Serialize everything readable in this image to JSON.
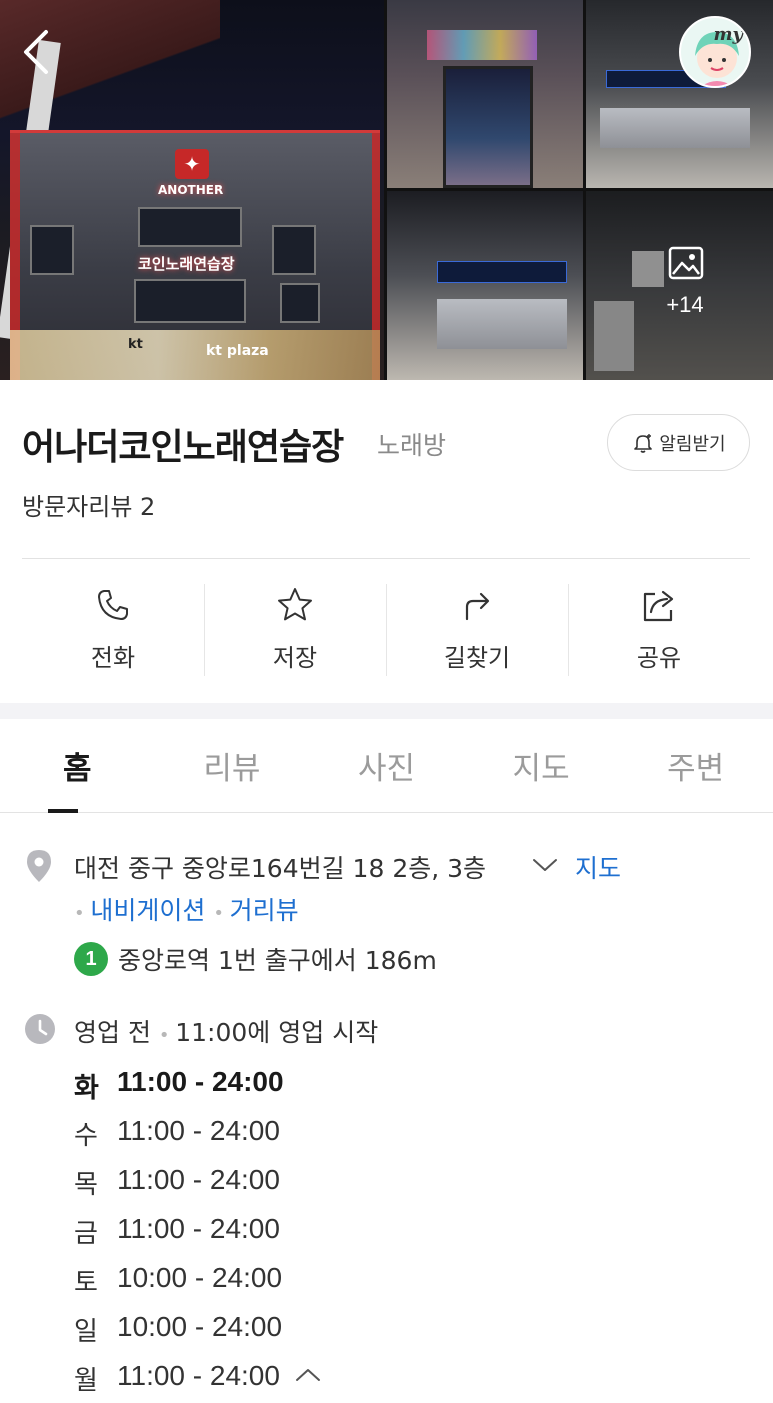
{
  "gallery": {
    "signs": {
      "brand": "ANOTHER",
      "korean": "코인노래연습장",
      "kt": "kt",
      "kt_plaza": "kt plaza"
    },
    "more_count": "+14",
    "my_badge": "my"
  },
  "place": {
    "title": "어나더코인노래연습장",
    "category": "노래방",
    "alert_label": "알림받기",
    "review_count": "방문자리뷰 2"
  },
  "actions": [
    {
      "label": "전화",
      "icon": "phone-icon"
    },
    {
      "label": "저장",
      "icon": "star-icon"
    },
    {
      "label": "길찾기",
      "icon": "directions-icon"
    },
    {
      "label": "공유",
      "icon": "share-icon"
    }
  ],
  "tabs": [
    {
      "label": "홈",
      "active": true
    },
    {
      "label": "리뷰",
      "active": false
    },
    {
      "label": "사진",
      "active": false
    },
    {
      "label": "지도",
      "active": false
    },
    {
      "label": "주변",
      "active": false
    }
  ],
  "info": {
    "address": "대전 중구 중앙로164번길 18 2층, 3층",
    "map_link": "지도",
    "navigation_link": "내비게이션",
    "street_view_link": "거리뷰",
    "subway_line": "1",
    "subway_line_color": "#2ea84a",
    "subway_text": "중앙로역 1번 출구에서 186m",
    "status": "영업 전",
    "status_detail": "11:00에 영업 시작",
    "hours": [
      {
        "day": "화",
        "time": "11:00 - 24:00",
        "today": true
      },
      {
        "day": "수",
        "time": "11:00 - 24:00",
        "today": false
      },
      {
        "day": "목",
        "time": "11:00 - 24:00",
        "today": false
      },
      {
        "day": "금",
        "time": "11:00 - 24:00",
        "today": false
      },
      {
        "day": "토",
        "time": "10:00 - 24:00",
        "today": false
      },
      {
        "day": "일",
        "time": "10:00 - 24:00",
        "today": false
      },
      {
        "day": "월",
        "time": "11:00 - 24:00",
        "today": false
      }
    ]
  },
  "colors": {
    "link": "#1e6fd0",
    "text": "#333333",
    "muted": "#8a8a8a",
    "accent_red": "#c62828"
  }
}
